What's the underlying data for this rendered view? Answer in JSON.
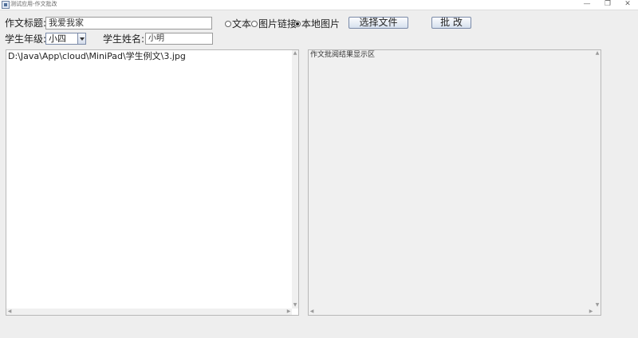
{
  "window": {
    "title": "测试应用-作文批改",
    "minimize": "—",
    "maximize": "❐",
    "close": "✕"
  },
  "form": {
    "essay_title_label": "作文标题:",
    "essay_title_value": "我爱我家",
    "grade_label": "学生年级:",
    "grade_value": "小四",
    "student_name_label": "学生姓名:",
    "student_name_value": "小明"
  },
  "source_options": [
    {
      "label": "文本",
      "checked": false
    },
    {
      "label": "图片链接",
      "checked": false
    },
    {
      "label": "本地图片",
      "checked": true
    }
  ],
  "buttons": {
    "choose_file": "选择文件",
    "grade": "批 改"
  },
  "input_panel": {
    "text": "D:\\Java\\App\\cloud\\MiniPad\\学生例文\\3.jpg"
  },
  "result_panel": {
    "text": "作文批阅结果显示区"
  },
  "icons": {
    "up": "▲",
    "down": "▼",
    "left": "◀",
    "right": "▶"
  }
}
